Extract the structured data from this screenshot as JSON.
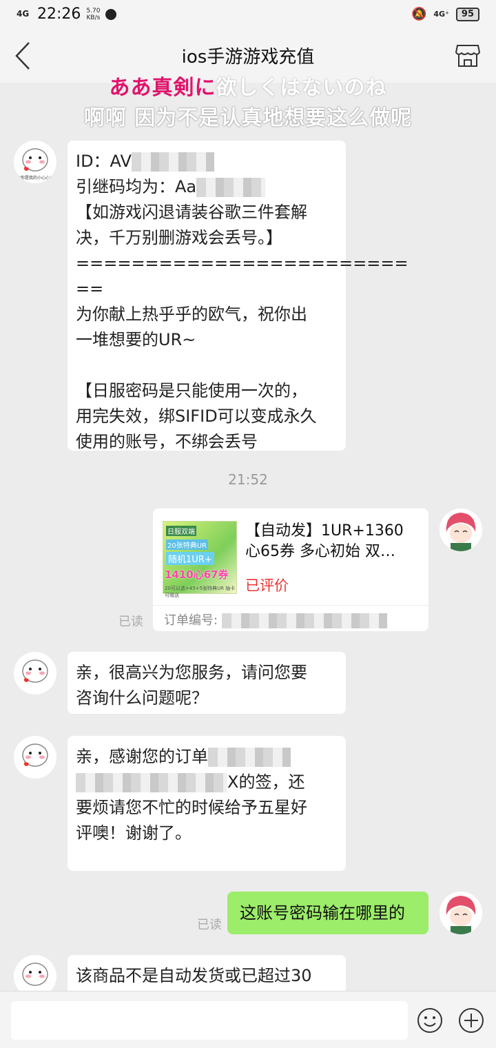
{
  "status_bar": {
    "signal": "4G",
    "time": "22:26",
    "speed_value": "5.70",
    "speed_unit": "KB/s",
    "network": "4G⁺",
    "battery": "95"
  },
  "nav": {
    "title": "ios手游游戏充值"
  },
  "overlay_caption": {
    "line1_pink": "ああ真剣に",
    "line1_white": "欲しくはないのね",
    "line2": "啊啊 因为不是认真地想要这么做呢"
  },
  "messages": {
    "m1": {
      "line_id": "ID：AV",
      "line_code": "引继码均为：Aa",
      "rest": "【如游戏闪退请装谷歌三件套解\n决，千万别删游戏会丢号。】\n========================\n==\n为你献上热乎乎的欧气，祝你出\n一堆想要的UR~\n\n【日服密码是只能使用一次的，\n用完失效，绑SIFID可以变成永久\n使用的账号，不绑会丢号"
    },
    "timestamp": "21:52",
    "order": {
      "img_t1": "日服双端",
      "img_t2": "20张特典UR",
      "img_t3": "随机1UR+",
      "img_t4": "1410心67券",
      "img_t5": "20可以选+45+5张特典UR 抽卡可赠送",
      "title": "【自动发】1UR+1360心65券 多心初始 双…",
      "status": "已评价",
      "order_label": "订单编号:",
      "read": "已读"
    },
    "m2": "亲，很高兴为您服务，请问您要\n咨询什么问题呢？",
    "m3": {
      "line1": "亲，感谢您的订单",
      "line2_tail": "X的签，还",
      "line3": "要烦请您不忙的时候给予五星好\n评噢！谢谢了。"
    },
    "m4": {
      "text": "这账号密码输在哪里的",
      "read": "已读"
    },
    "m5": "该商品不是自动发货或已超过30"
  },
  "avatar_caption": "*你是我的小心心*",
  "input": {
    "placeholder": ""
  },
  "colors": {
    "accent_pink": "#e0136c",
    "bubble_green": "#9ced6a",
    "status_red": "#e33333",
    "background": "#ececec"
  }
}
